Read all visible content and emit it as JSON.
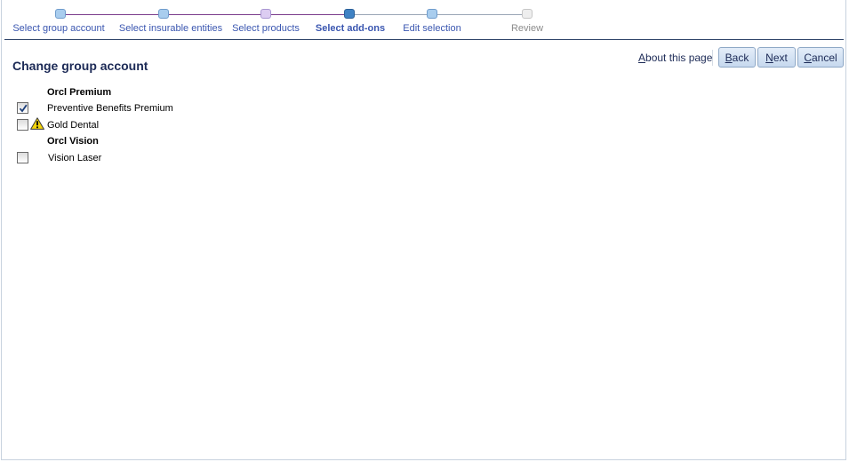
{
  "train": {
    "steps": [
      {
        "label": "Select group account",
        "state": "visited",
        "node_color": "#a9cdee",
        "node_border": "#6f9ccc",
        "label_color": "#3a56b0"
      },
      {
        "label": "Select insurable entities",
        "state": "visited",
        "node_color": "#a9cdee",
        "node_border": "#6f9ccc",
        "label_color": "#3a56b0"
      },
      {
        "label": "Select products",
        "state": "visited",
        "node_color": "#dccdf2",
        "node_border": "#a996d2",
        "label_color": "#3a56b0"
      },
      {
        "label": "Select add-ons",
        "state": "current",
        "node_color": "#3f82c4",
        "node_border": "#2a5f98",
        "label_color": "#3a56b0"
      },
      {
        "label": "Edit selection",
        "state": "next",
        "node_color": "#a9cdee",
        "node_border": "#6f9ccc",
        "label_color": "#3a56b0"
      },
      {
        "label": "Review",
        "state": "disabled",
        "node_color": "#eeeeee",
        "node_border": "#c6c6c6",
        "label_color": "#8a8a8a"
      }
    ],
    "visited_line_color": "#7a3c8c",
    "unvisited_line_color": "#9aa6b6"
  },
  "header": {
    "title": "Change group account",
    "about_link": "About this page",
    "back_label": "Back",
    "next_label": "Next",
    "cancel_label": "Cancel"
  },
  "groups": [
    {
      "name": "Orcl Premium",
      "items": [
        {
          "label": "Preventive Benefits Premium",
          "checked": true,
          "warning": false
        },
        {
          "label": "Gold Dental",
          "checked": false,
          "warning": true
        }
      ]
    },
    {
      "name": "Orcl Vision",
      "items": [
        {
          "label": "Vision Laser",
          "checked": false,
          "warning": false
        }
      ]
    }
  ],
  "icons": {
    "checkmark": "checkmark-icon",
    "warning": "warning-triangle-icon"
  },
  "colors": {
    "accent": "#1c2a56",
    "divider": "#30456a",
    "warning_fill": "#f5d50a"
  }
}
